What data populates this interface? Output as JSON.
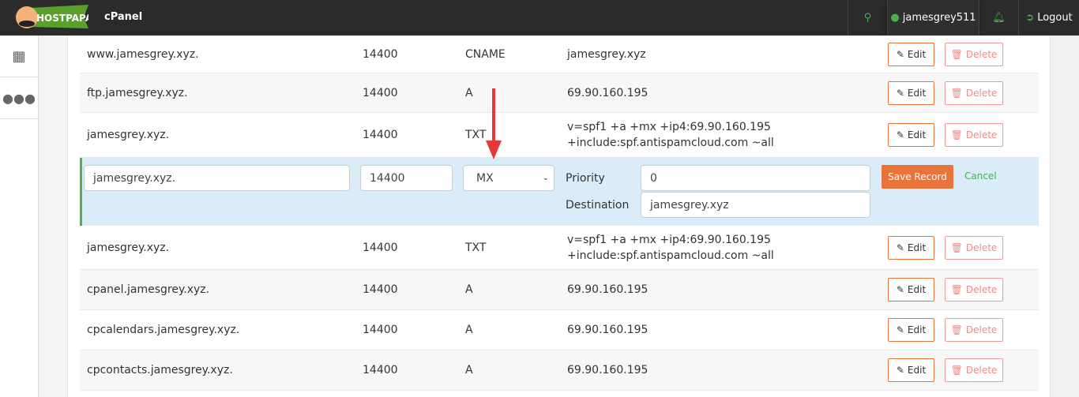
{
  "header": {
    "brand": "HOSTPAPA",
    "app": "cPanel",
    "user": "jamesgrey511",
    "logout": "Logout"
  },
  "records": [
    {
      "name": "www.jamesgrey.xyz.",
      "ttl": "14400",
      "type": "CNAME",
      "record": "jamesgrey.xyz"
    },
    {
      "name": "ftp.jamesgrey.xyz.",
      "ttl": "14400",
      "type": "A",
      "record": "69.90.160.195"
    },
    {
      "name": "jamesgrey.xyz.",
      "ttl": "14400",
      "type": "TXT",
      "record": "v=spf1 +a +mx +ip4:69.90.160.195 +include:spf.antispamcloud.com ~all"
    },
    {
      "name": "jamesgrey.xyz.",
      "ttl": "14400",
      "type": "TXT",
      "record": "v=spf1 +a +mx +ip4:69.90.160.195 +include:spf.antispamcloud.com ~all"
    },
    {
      "name": "cpanel.jamesgrey.xyz.",
      "ttl": "14400",
      "type": "A",
      "record": "69.90.160.195"
    },
    {
      "name": "cpcalendars.jamesgrey.xyz.",
      "ttl": "14400",
      "type": "A",
      "record": "69.90.160.195"
    },
    {
      "name": "cpcontacts.jamesgrey.xyz.",
      "ttl": "14400",
      "type": "A",
      "record": "69.90.160.195"
    }
  ],
  "actions": {
    "edit": "Edit",
    "delete": "Delete"
  },
  "edit_row": {
    "name": "jamesgrey.xyz.",
    "ttl": "14400",
    "type": "MX",
    "priority_label": "Priority",
    "priority": "0",
    "destination_label": "Destination",
    "destination": "jamesgrey.xyz",
    "save": "Save Record",
    "cancel": "Cancel"
  }
}
